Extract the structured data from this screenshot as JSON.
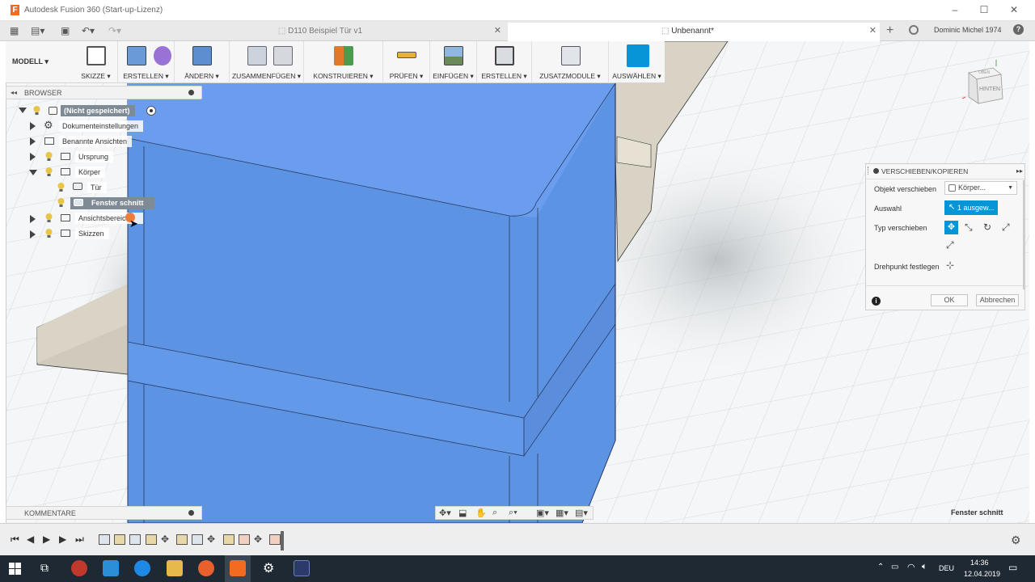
{
  "window": {
    "app_icon_letter": "F",
    "title": "Autodesk Fusion 360 (Start-up-Lizenz)",
    "minimize": "–",
    "maximize": "☐",
    "close": "✕"
  },
  "tabs": {
    "inactive_title": "D110 Beispiel Tür v1",
    "active_title": "Unbenannt*",
    "close_glyph": "✕",
    "new_tab_glyph": "+",
    "user": "Dominic Michel 1974",
    "help": "?"
  },
  "toolbar": {
    "workspace": "MODELL ▾",
    "groups": [
      {
        "label": "SKIZZE ▾"
      },
      {
        "label": "ERSTELLEN ▾"
      },
      {
        "label": "ÄNDERN ▾"
      },
      {
        "label": "ZUSAMMENFÜGEN ▾"
      },
      {
        "label": "KONSTRUIEREN ▾"
      },
      {
        "label": "PRÜFEN ▾"
      },
      {
        "label": "EINFÜGEN ▾"
      },
      {
        "label": "ERSTELLEN ▾"
      },
      {
        "label": "ZUSATZMODULE ▾"
      },
      {
        "label": "AUSWÄHLEN ▾"
      }
    ]
  },
  "viewcube": {
    "face_front": "HINTEN",
    "face_top": "OBEN"
  },
  "browser": {
    "title": "BROWSER",
    "collapse_glyph": "◂◂",
    "root": "(Nicht gespeichert)",
    "items": [
      {
        "label": "Dokumenteinstellungen"
      },
      {
        "label": "Benannte Ansichten"
      },
      {
        "label": "Ursprung"
      },
      {
        "label": "Körper"
      },
      {
        "label": "Tür"
      },
      {
        "label": "Fenster schnitt"
      },
      {
        "label": "Ansichtsbereich"
      },
      {
        "label": "Skizzen"
      }
    ]
  },
  "dialog": {
    "title": "VERSCHIEBEN/KOPIEREN",
    "rows": [
      {
        "label": "Objekt verschieben",
        "value": "Körper..."
      },
      {
        "label": "Auswahl",
        "value": "1 ausgew..."
      },
      {
        "label": "Typ verschieben"
      },
      {
        "label": "Drehpunkt festlegen"
      }
    ],
    "ok": "OK",
    "cancel": "Abbrechen",
    "info": "i"
  },
  "comments": {
    "title": "KOMMENTARE"
  },
  "status": {
    "selection": "Fenster schnitt"
  },
  "taskbar": {
    "language": "DEU",
    "time": "14:36",
    "date": "12.04.2019"
  },
  "colors": {
    "accent": "#0696d7",
    "body_blue": "#5b8fdf",
    "taskbar": "#1f2933"
  }
}
